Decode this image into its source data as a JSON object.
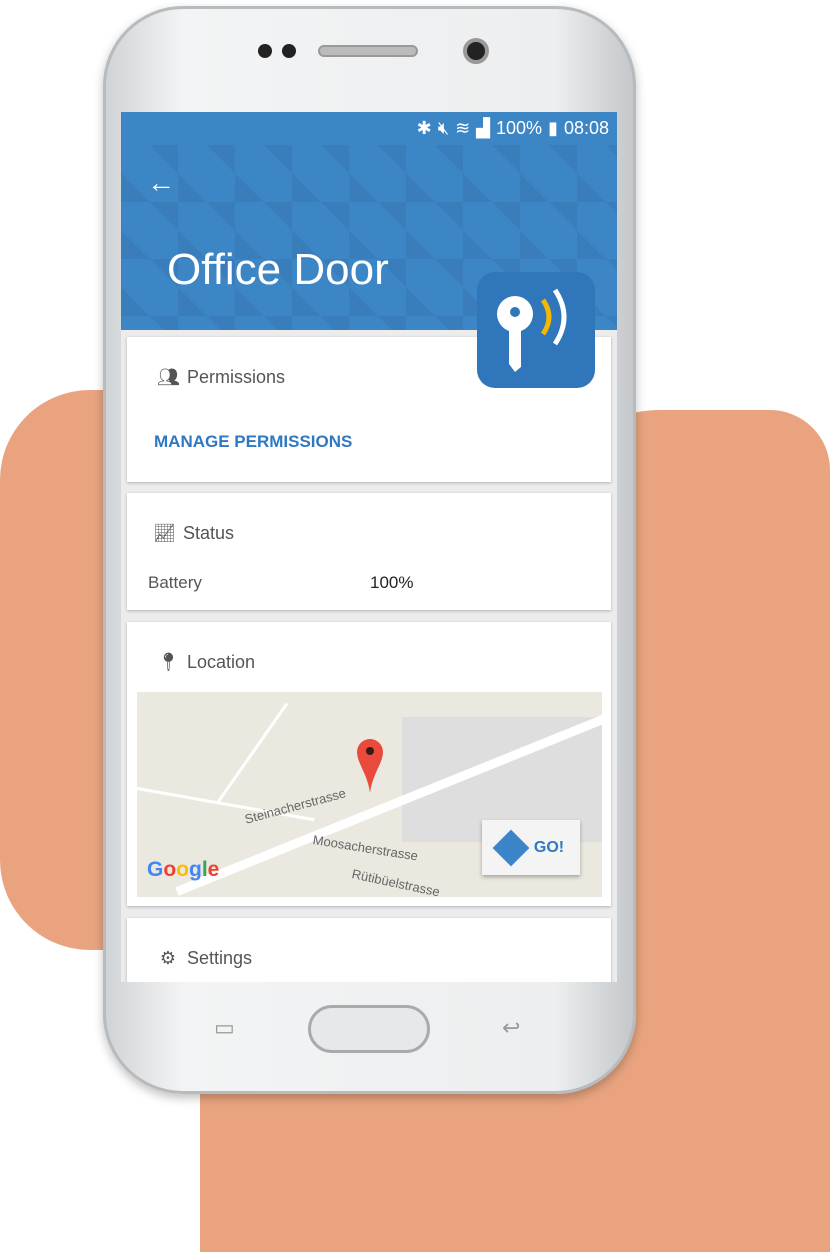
{
  "status_bar": {
    "battery": "100%",
    "time": "08:08"
  },
  "header": {
    "title": "Office Door"
  },
  "permissions": {
    "title": "Permissions",
    "action": "MANAGE PERMISSIONS"
  },
  "status": {
    "title": "Status",
    "battery_label": "Battery",
    "battery_value": "100%"
  },
  "location": {
    "title": "Location",
    "streets": [
      "Steinacherstrasse",
      "Moosacherstrasse",
      "Rütibüelstrasse"
    ],
    "go_label": "GO!",
    "map_logo": "Google"
  },
  "settings": {
    "title": "Settings"
  },
  "colors": {
    "primary": "#3d86c6",
    "accent": "#f5b700",
    "link": "#2f78c2"
  }
}
